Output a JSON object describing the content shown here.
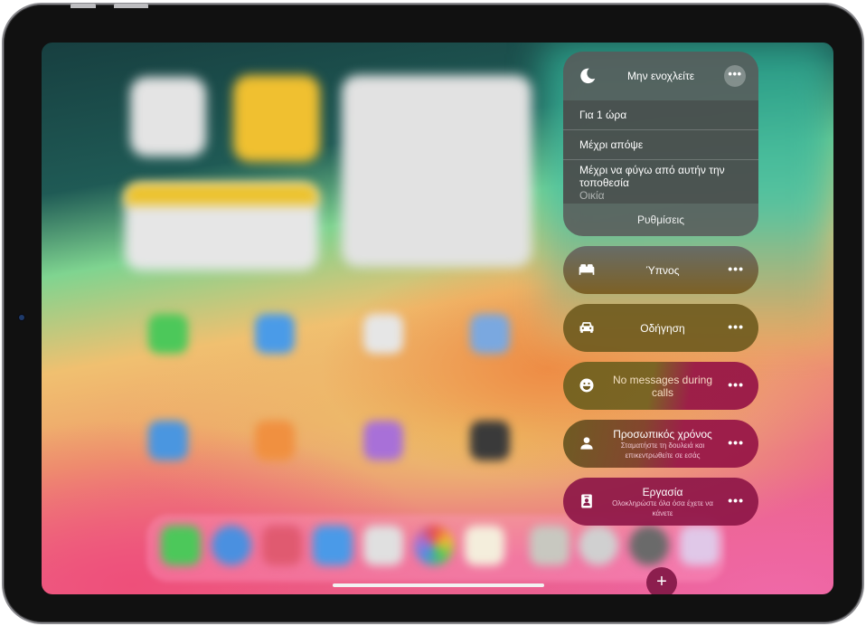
{
  "focus_panel": {
    "do_not_disturb": {
      "title": "Μην ενοχλείτε",
      "icon": "moon-icon",
      "more": "•••",
      "options": [
        {
          "label": "Για 1 ώρα"
        },
        {
          "label": "Μέχρι απόψε"
        },
        {
          "label": "Μέχρι να φύγω από αυτήν την τοποθεσία",
          "sublabel": "Οικία"
        }
      ],
      "settings_label": "Ρυθμίσεις"
    },
    "modes": [
      {
        "title": "Ύπνος",
        "subtitle": "",
        "icon": "bed-icon",
        "more": "•••"
      },
      {
        "title": "Οδήγηση",
        "subtitle": "",
        "icon": "car-icon",
        "more": "•••"
      },
      {
        "title": "No messages during calls",
        "subtitle": "",
        "icon": "smiley-icon",
        "more": "•••"
      },
      {
        "title": "Προσωπικός χρόνος",
        "subtitle": "Σταματήστε τη δουλειά και επικεντρωθείτε σε εσάς",
        "icon": "person-icon",
        "more": "•••"
      },
      {
        "title": "Εργασία",
        "subtitle": "Ολοκληρώστε όλα όσα έχετε να κάνετε",
        "icon": "id-badge-icon",
        "more": "•••"
      }
    ],
    "add_label": "+"
  },
  "colors": {
    "work_accent": "#8c1e4e",
    "panel_gray": "#5a5a5a"
  }
}
